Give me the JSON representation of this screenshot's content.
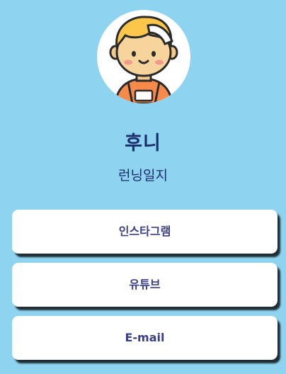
{
  "profile": {
    "name": "후니",
    "subtitle": "런닝일지",
    "avatar_icon": "runner-avatar-icon"
  },
  "links": [
    {
      "label": "인스타그램"
    },
    {
      "label": "유튜브"
    },
    {
      "label": "E-mail"
    }
  ],
  "colors": {
    "background": "#8ED3EF",
    "name_text": "#1C2D6E",
    "button_text": "#3A3F86",
    "button_bg": "#FFFFFF"
  }
}
